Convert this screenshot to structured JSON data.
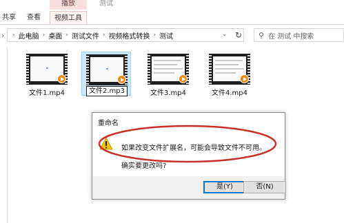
{
  "ribbon": {
    "context_group": "播放",
    "title": "测试",
    "tabs": [
      {
        "label": "共享"
      },
      {
        "label": "查看"
      },
      {
        "label": "视频工具"
      }
    ]
  },
  "address": {
    "crumbs": [
      "此电脑",
      "桌面",
      "测试文件",
      "视频格式转换",
      "测试"
    ],
    "search_placeholder": "在 测试 中搜索"
  },
  "files": [
    {
      "name": "文件1.mp4",
      "selected": false
    },
    {
      "name": "文件2.mp3",
      "selected": true,
      "renaming": true
    },
    {
      "name": "文件3.mp4",
      "selected": false
    },
    {
      "name": "文件4.mp4",
      "selected": false
    }
  ],
  "dialog": {
    "title": "重命名",
    "message": "如果改变文件扩展名，可能会导致文件不可用。",
    "confirm": "确实要更改吗?",
    "yes_label": "是(Y)",
    "no_label": "否(N)"
  },
  "colors": {
    "context_tab": "#f8dfe0",
    "selection": "#cce8ff",
    "play_badge": "#ef8a12",
    "annotation": "#c8302b",
    "default_button_border": "#0078d7"
  }
}
